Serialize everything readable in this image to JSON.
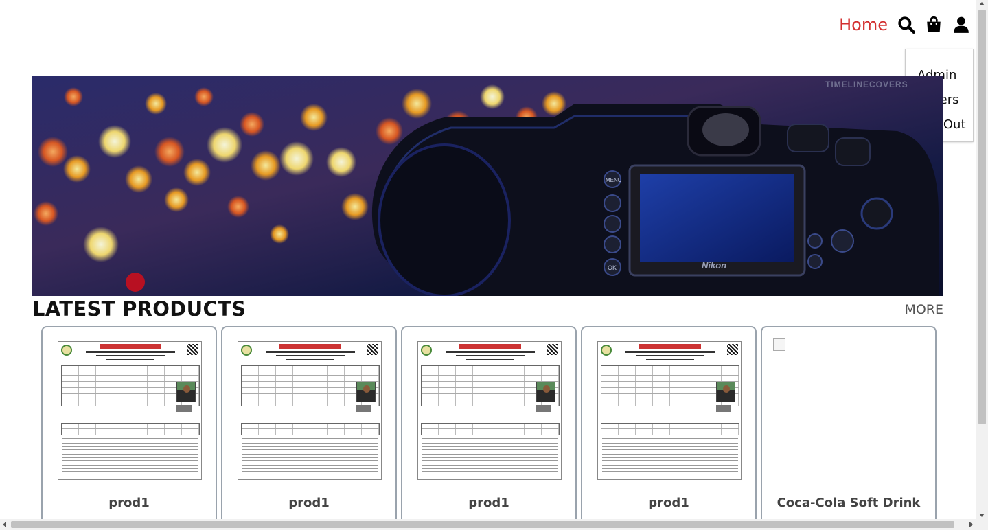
{
  "nav": {
    "home_label": "Home",
    "icons": [
      "search-icon",
      "shopping-bag-icon",
      "user-icon"
    ]
  },
  "user_menu": {
    "items": [
      {
        "label": "Admin"
      },
      {
        "label": "Orders"
      },
      {
        "label": "Log Out"
      }
    ]
  },
  "banner": {
    "watermark": "TIMELINECOVERS",
    "camera_brand": "Nikon",
    "camera_labels": [
      "MENU",
      "OK"
    ]
  },
  "latest": {
    "title": "LATEST PRODUCTS",
    "more_label": "MORE"
  },
  "products": [
    {
      "name": "prod1",
      "image": "admit-card-document"
    },
    {
      "name": "prod1",
      "image": "admit-card-document"
    },
    {
      "name": "prod1",
      "image": "admit-card-document"
    },
    {
      "name": "prod1",
      "image": "admit-card-document"
    },
    {
      "name": "Coca-Cola Soft Drink",
      "image": "broken-image"
    }
  ],
  "colors": {
    "nav_link": "#d32f2f",
    "card_border": "#9aa3ad"
  }
}
